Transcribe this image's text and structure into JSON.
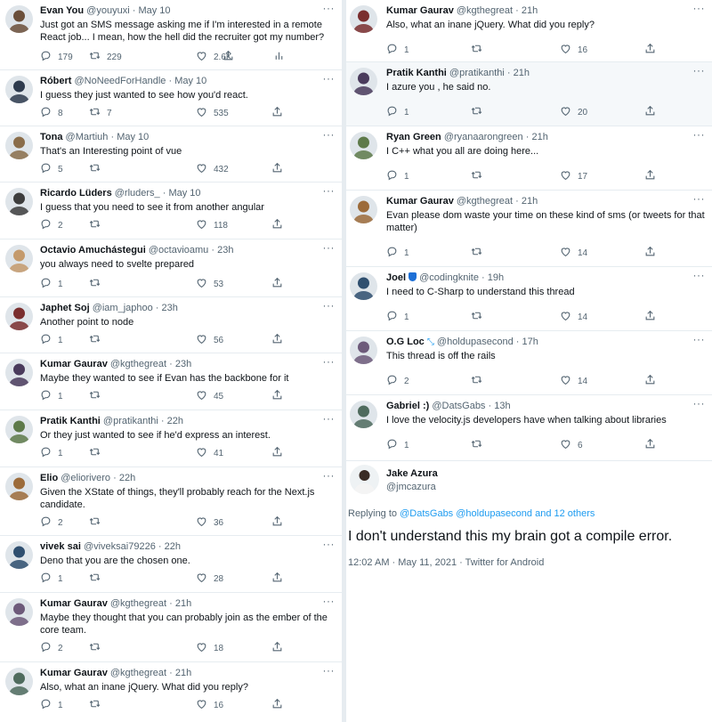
{
  "colors": {
    "accent": "#1d9bf0",
    "muted": "#536471",
    "text": "#0f1419",
    "border": "#e6ecf0"
  },
  "left": [
    {
      "name": "Evan You",
      "handle": "@youyuxi",
      "time": "May 10",
      "text": "Just got an SMS message asking me if I'm interested in a remote React job... I mean, how the hell did the recruiter got my number?",
      "replies": "179",
      "retweets": "229",
      "likes": "2.6K",
      "has_analytics": true
    },
    {
      "name": "Róbert",
      "handle": "@NoNeedForHandle",
      "time": "May 10",
      "text": "I guess they just wanted to see how you'd react.",
      "replies": "8",
      "retweets": "7",
      "likes": "535"
    },
    {
      "name": "Tona",
      "handle": "@Martiuh",
      "time": "May 10",
      "text": "That's an Interesting point of vue",
      "replies": "5",
      "retweets": "",
      "likes": "432"
    },
    {
      "name": "Ricardo Lüders",
      "handle": "@rluders_",
      "time": "May 10",
      "text": "I guess that you need to see it from another angular",
      "replies": "2",
      "retweets": "",
      "likes": "118"
    },
    {
      "name": "Octavio Amuchástegui",
      "handle": "@octavioamu",
      "time": "23h",
      "text": "you always need to svelte prepared",
      "replies": "1",
      "retweets": "",
      "likes": "53"
    },
    {
      "name": "Japhet Soj",
      "handle": "@iam_japhoo",
      "time": "23h",
      "text": "Another point to node",
      "replies": "1",
      "retweets": "",
      "likes": "56"
    },
    {
      "name": "Kumar Gaurav",
      "handle": "@kgthegreat",
      "time": "23h",
      "text": "Maybe they wanted to see if Evan has the backbone for it",
      "replies": "1",
      "retweets": "",
      "likes": "45"
    },
    {
      "name": "Pratik Kanthi",
      "handle": "@pratikanthi",
      "time": "22h",
      "text": "Or they just wanted to see if he'd express an interest.",
      "replies": "1",
      "retweets": "",
      "likes": "41"
    },
    {
      "name": "Elio",
      "handle": "@eliorivero",
      "time": "22h",
      "text": "Given the XState of things, they'll probably reach for the Next.js candidate.",
      "replies": "2",
      "retweets": "",
      "likes": "36"
    },
    {
      "name": "vivek sai",
      "handle": "@viveksai79226",
      "time": "22h",
      "text": "Deno that you are the chosen one.",
      "replies": "1",
      "retweets": "",
      "likes": "28"
    },
    {
      "name": "Kumar Gaurav",
      "handle": "@kgthegreat",
      "time": "21h",
      "text": "Maybe they thought that you can probably join as the ember of the core team.",
      "replies": "2",
      "retweets": "",
      "likes": "18"
    },
    {
      "name": "Kumar Gaurav",
      "handle": "@kgthegreat",
      "time": "21h",
      "text": "Also, what an inane jQuery. What did you reply?",
      "replies": "1",
      "retweets": "",
      "likes": "16"
    }
  ],
  "right": [
    {
      "name": "Kumar Gaurav",
      "handle": "@kgthegreat",
      "time": "21h",
      "text": "Also, what an inane jQuery. What did you reply?",
      "replies": "1",
      "retweets": "",
      "likes": "16"
    },
    {
      "name": "Pratik Kanthi",
      "handle": "@pratikanthi",
      "time": "21h",
      "text": "I azure you , he said no.",
      "replies": "1",
      "retweets": "",
      "likes": "20"
    },
    {
      "name": "Ryan Green",
      "handle": "@ryanaarongreen",
      "time": "21h",
      "text": "I C++ what you all are doing here...",
      "replies": "1",
      "retweets": "",
      "likes": "17"
    },
    {
      "name": "Kumar Gaurav",
      "handle": "@kgthegreat",
      "time": "21h",
      "text": "Evan please dom waste your time on these kind of sms (or tweets for that matter)",
      "replies": "1",
      "retweets": "",
      "likes": "14"
    },
    {
      "name": "Joel",
      "handle": "@codingknite",
      "time": "19h",
      "text": "I need to C-Sharp to understand this thread",
      "replies": "1",
      "retweets": "",
      "likes": "14",
      "badge": "shield"
    },
    {
      "name": "O.G Loc",
      "handle": "@holdupasecond",
      "time": "17h",
      "text": "This thread is off the rails",
      "replies": "2",
      "retweets": "",
      "likes": "14",
      "badge": "dna"
    },
    {
      "name": "Gabriel :)",
      "handle": "@DatsGabs",
      "time": "13h",
      "text": "I love the velocity.js developers have when talking about libraries",
      "replies": "1",
      "retweets": "",
      "likes": "6"
    }
  ],
  "focus": {
    "name": "Jake Azura",
    "handle": "@jmcazura",
    "replying_prefix": "Replying to",
    "replying_links": "@DatsGabs @holdupasecond and 12 others",
    "text": "I don't understand this my brain got a compile error.",
    "meta": "12:02 AM · May 11, 2021 · Twitter for Android"
  }
}
